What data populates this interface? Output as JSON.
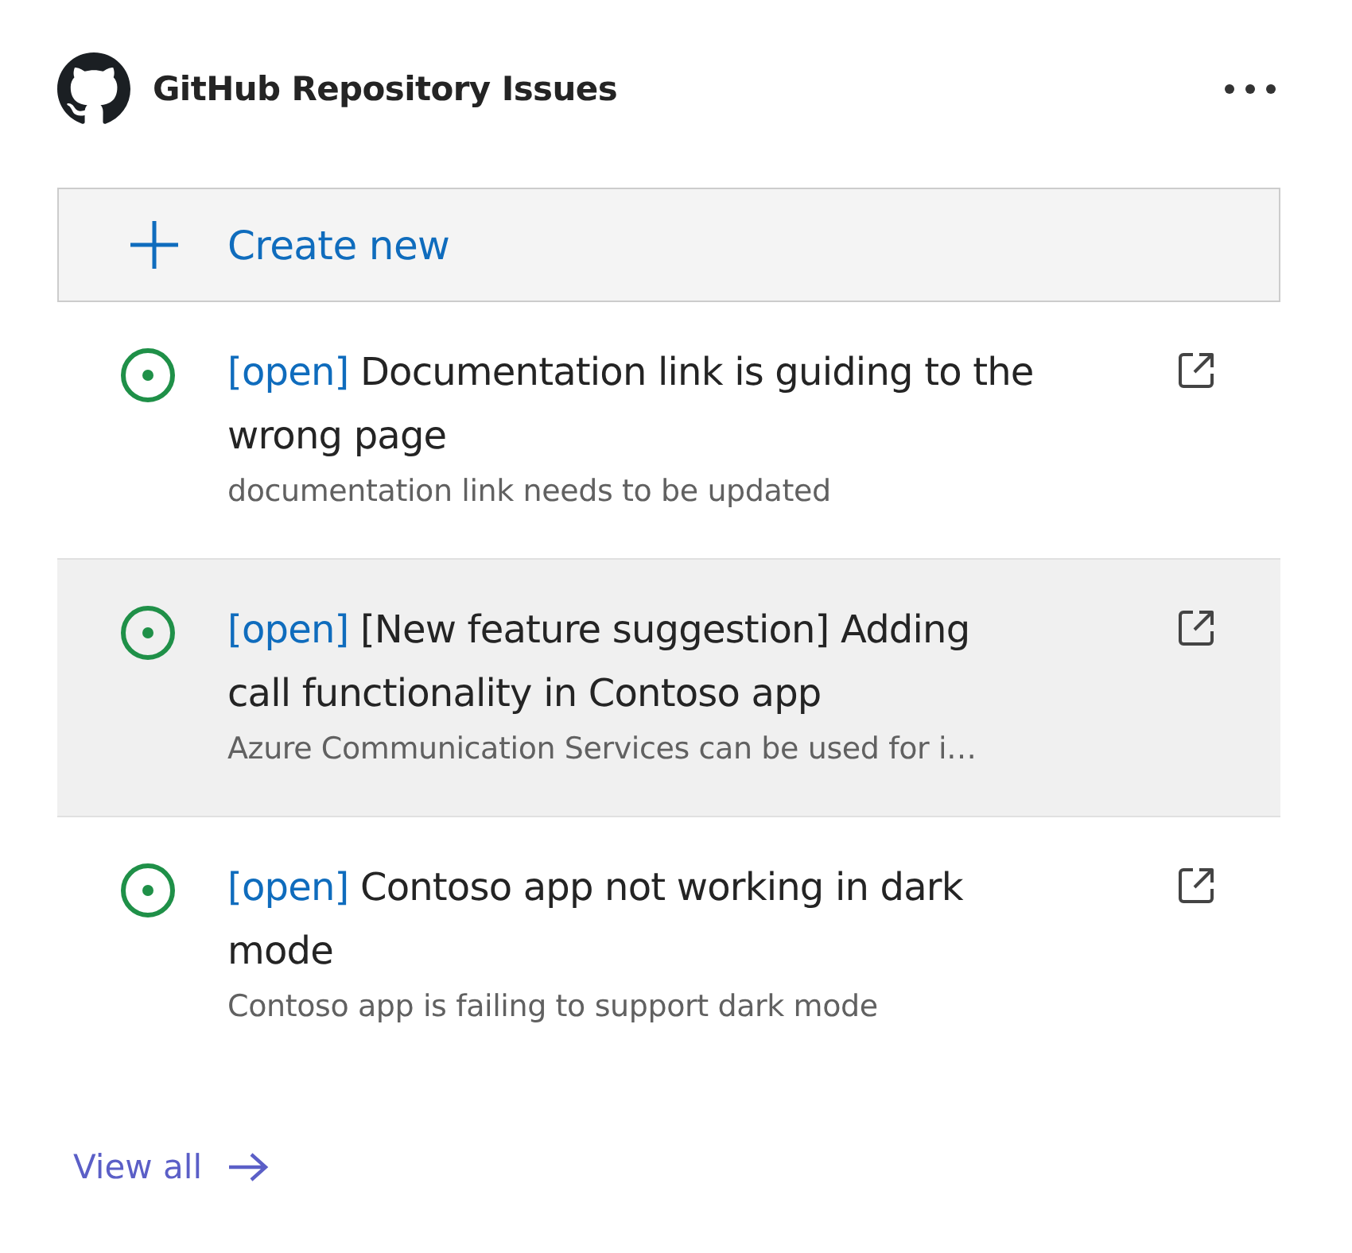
{
  "header": {
    "title": "GitHub Repository Issues"
  },
  "create_button": {
    "label": "Create new"
  },
  "issues": [
    {
      "status": "[open]",
      "title": "Documentation link is guiding to the wrong page",
      "description": "documentation link needs to be updated",
      "selected": false
    },
    {
      "status": "[open]",
      "title": "[New feature suggestion] Adding call functionality in Contoso app",
      "description": "Azure Communication Services can be used for i…",
      "selected": true
    },
    {
      "status": "[open]",
      "title": "Contoso app not working in dark mode",
      "description": "Contoso app is failing to support dark mode",
      "selected": false
    }
  ],
  "footer": {
    "link": "View all"
  }
}
